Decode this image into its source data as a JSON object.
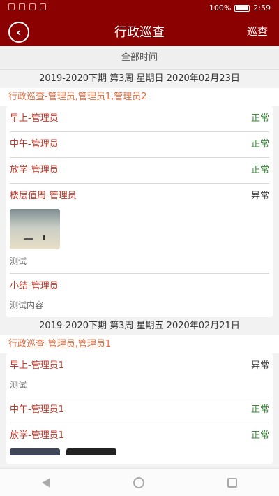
{
  "status_bar": {
    "battery": "100%",
    "time": "2:59"
  },
  "header": {
    "title": "行政巡查",
    "action": "巡查"
  },
  "filter": {
    "label": "全部时间"
  },
  "sections": [
    {
      "date": "2019-2020下期 第3周 星期日 2020年02月23日",
      "group": "行政巡查-管理员,管理员1,管理员2",
      "items": [
        {
          "name": "早上-管理员",
          "status": "正常"
        },
        {
          "name": "中午-管理员",
          "status": "正常"
        },
        {
          "name": "放学-管理员",
          "status": "正常"
        },
        {
          "name": "楼层值周-管理员",
          "status": "异常",
          "remark": "测试"
        },
        {
          "name": "小结-管理员",
          "remark": "测试内容"
        }
      ]
    },
    {
      "date": "2019-2020下期 第3周 星期五 2020年02月21日",
      "group": "行政巡查-管理员,管理员1",
      "items": [
        {
          "name": "早上-管理员1",
          "status": "异常",
          "remark": "测试"
        },
        {
          "name": "中午-管理员1",
          "status": "正常"
        },
        {
          "name": "放学-管理员1",
          "status": "正常"
        }
      ]
    }
  ]
}
